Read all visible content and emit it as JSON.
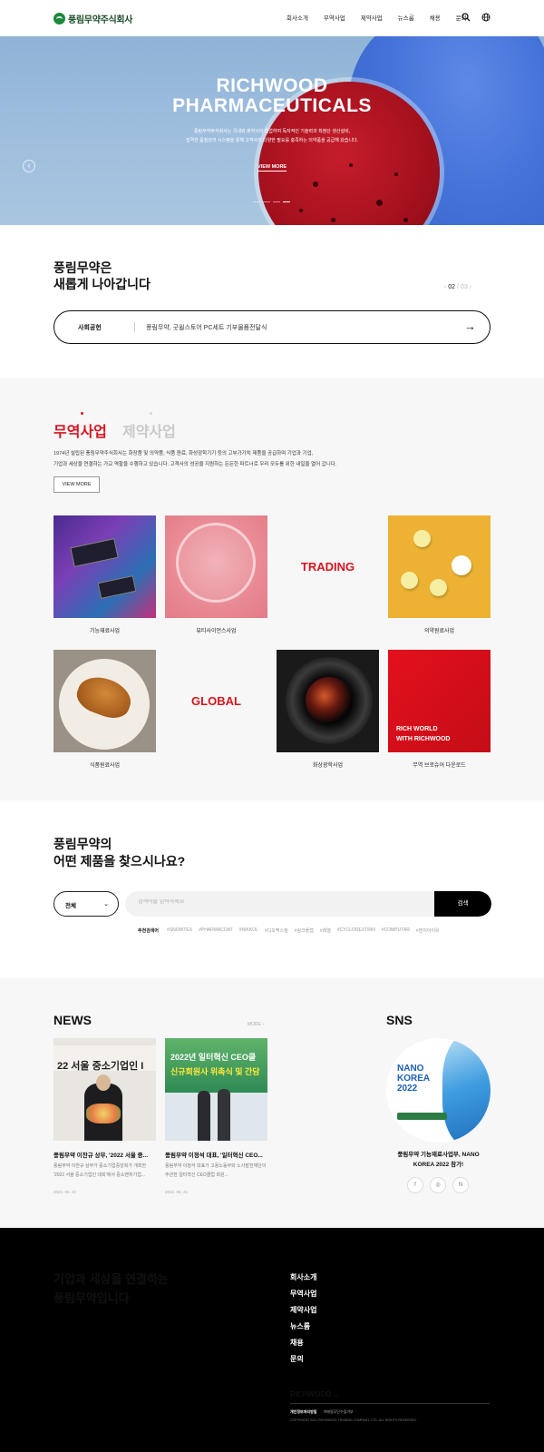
{
  "header": {
    "logo_text": "풍림무약주식회사",
    "nav": [
      "회사소개",
      "무역사업",
      "제약사업",
      "뉴스룸",
      "채용",
      "문의"
    ],
    "icons": [
      "search-icon",
      "globe-icon"
    ]
  },
  "hero": {
    "title_line1": "RICHWOOD",
    "title_line2": "PHARMACEUTICALS",
    "desc_line1": "풍림무약주식회사는 국내외 제약사와 협업하여 독자적인 기술력과 최첨단 생산설비,",
    "desc_line2": "엄격한 품질관리 시스템을 통해 고객사의 다양한 필요를 충족하는 의약품을 공급해 왔습니다.",
    "button": "VIEW MORE",
    "slide_count": 4,
    "active_slide": 4
  },
  "intro": {
    "title_line1": "풍림무약은",
    "title_line2": "새롭게 나아갑니다",
    "counter_current": "02",
    "counter_sep": "/",
    "counter_total": "03",
    "news_category": "사회공헌",
    "news_text": "풍림무약, 굿윌스토어 PC세트 기부물품전달식"
  },
  "business": {
    "tab_active": "무역사업",
    "tab_inactive": "제약사업",
    "desc_line1": "1974년 설립된 풍림무약주식회사는 화장품 및 의약품, 식품 원료, 화성광학기기 등의 고부가가치 제품을 공급하며 기업과 기업,",
    "desc_line2": "기업과 세상을 연결하는 가교 역할을 수행하고 있습니다. 고객사의 성공을 지원하는 든든한 파트너로 우리 모두를 위한 내일을 열어 갑니다.",
    "button": "VIEW MORE",
    "tiles": {
      "functional": "기능재료사업",
      "beauty": "뷰티사이언스사업",
      "trading": "TRADING",
      "pharma": "의약원료사업",
      "food": "식품원료사업",
      "global": "GLOBAL",
      "optics": "화상광학사업",
      "brochure": "무역 브로슈어 다운로드",
      "brochure_img_line1": "RICH WORLD",
      "brochure_img_line2": "WITH RICHWOOD"
    }
  },
  "search": {
    "title_line1": "풍림무약의",
    "title_line2": "어떤 제품을 찾으시나요?",
    "select_value": "전체",
    "placeholder": "검색어를 입력하세요",
    "button": "검색",
    "keywords_label": "추천검색어",
    "keywords": [
      "#SNOWTEX",
      "#PHARMACOAT",
      "#NIKKOL",
      "#디오맥스첨",
      "#링크플랩",
      "#레엘",
      "#CYCLODEXTRIN",
      "#COMPUTAR",
      "#엔지아이유"
    ]
  },
  "news": {
    "heading": "NEWS",
    "more": "MORE",
    "items": [
      {
        "img_text": "22 서울 중소기업인 I",
        "title": "풍림무약 이찬규 상무, '2022 서울 중...",
        "desc": "풍림무약 이찬규 상무가 중소기업중앙회가 개최한 '2022 서울 중소기업인 대회'에서 중소벤처기업...",
        "date": "2022. 06. 22"
      },
      {
        "img_text_line1": "2022년 일터혁신 CEO클",
        "img_text_line2": "신규회원사 위촉식 및 간담",
        "title": "풍림무약 이정석 대표, '일터혁신 CEO...",
        "desc": "풍림무약 이정석 대표가 고용노동부와 노사발전재단이 주관한 일터혁신 CEO클럽 회원...",
        "date": "2022. 06. 21"
      }
    ]
  },
  "sns": {
    "heading": "SNS",
    "img_line1": "NANO",
    "img_line2": "KOREA",
    "img_line3": "2022",
    "caption": "풍림무약 기능재료사업부, NANO KOREA 2022 참가!",
    "icons": [
      "facebook-icon",
      "instagram-icon",
      "naver-blog-icon"
    ]
  },
  "footer": {
    "title_line1": "기업과 세상을 연결하는",
    "title_line2": "풍림무약입니다",
    "menu": [
      "회사소개",
      "무역사업",
      "제약사업",
      "뉴스룸",
      "채용",
      "문의"
    ],
    "brand": "RICHWOOD",
    "link1": "개인정보처리방침",
    "link2": "이메일무단수집거부",
    "copyright": "COPYRIGHT 2021 RICHWOOD TRADING COMPANY, LTD. ALL RIGHTS RESERVED."
  },
  "colors": {
    "accent": "#d8141f",
    "logo_green": "#1a8a3a",
    "footer_bg": "#000000"
  }
}
